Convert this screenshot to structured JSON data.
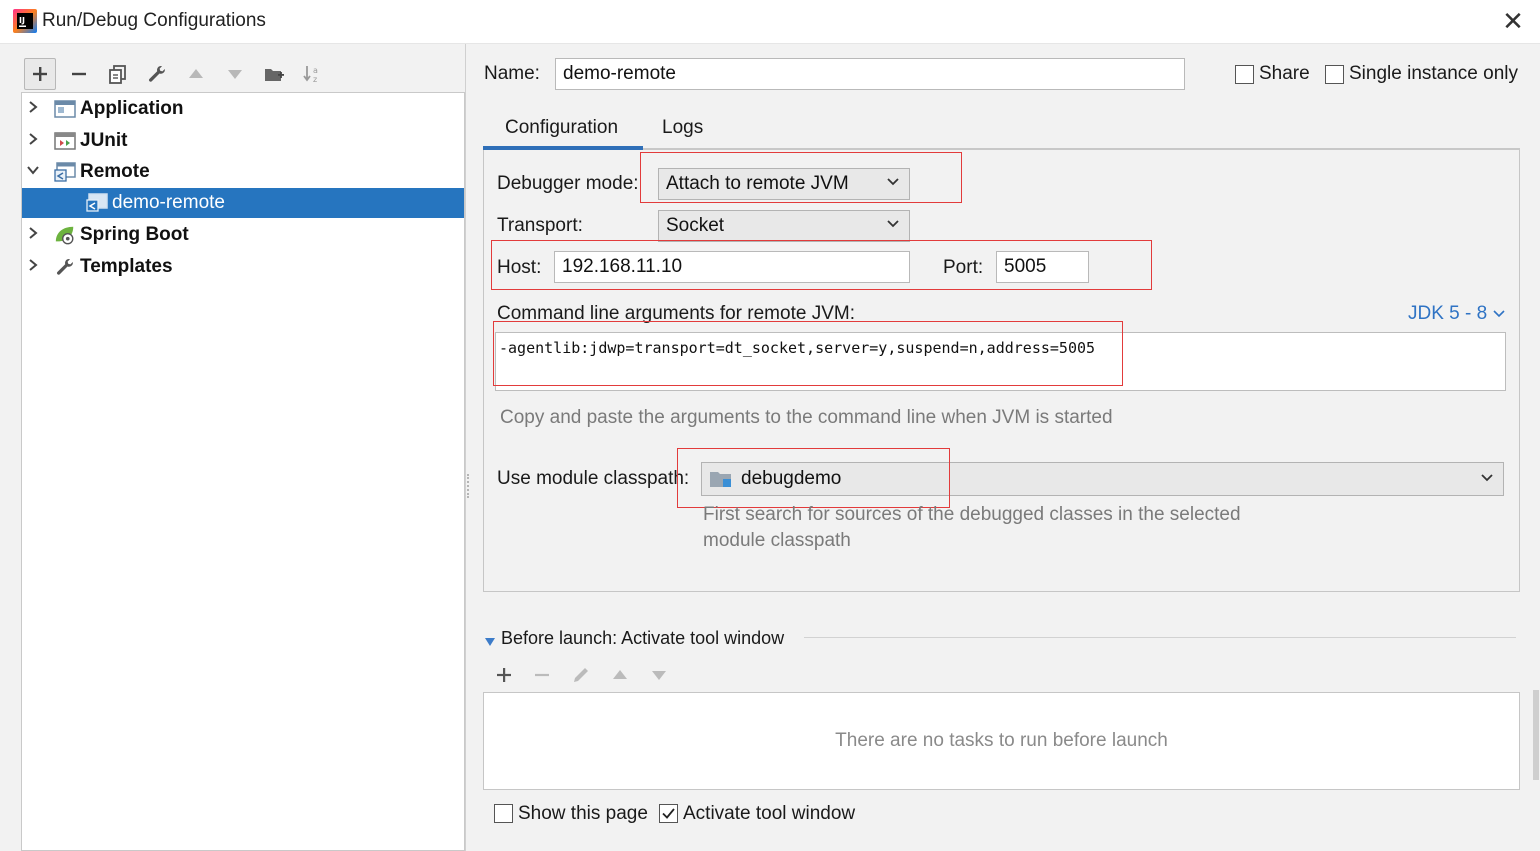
{
  "window": {
    "title": "Run/Debug Configurations",
    "close_glyph": "✕"
  },
  "left_toolbar": {
    "buttons": [
      {
        "name": "add",
        "glyph": "+"
      },
      {
        "name": "remove",
        "glyph": "−"
      },
      {
        "name": "copy",
        "glyph": "⧉"
      },
      {
        "name": "edit-defaults",
        "glyph": "🔧"
      },
      {
        "name": "move-up",
        "glyph": "▲"
      },
      {
        "name": "move-down",
        "glyph": "▼"
      },
      {
        "name": "new-folder",
        "glyph": "📁"
      },
      {
        "name": "sort",
        "glyph": "↓a"
      }
    ]
  },
  "tree": {
    "items": [
      {
        "label": "Application",
        "expanded": false,
        "icon": "application-icon"
      },
      {
        "label": "JUnit",
        "expanded": false,
        "icon": "junit-icon"
      },
      {
        "label": "Remote",
        "expanded": true,
        "icon": "remote-icon"
      },
      {
        "label": "demo-remote",
        "child": true,
        "selected": true,
        "icon": "remote-config-icon"
      },
      {
        "label": "Spring Boot",
        "expanded": false,
        "icon": "spring-boot-icon"
      },
      {
        "label": "Templates",
        "expanded": false,
        "icon": "wrench-icon"
      }
    ]
  },
  "header": {
    "name_label": "Name:",
    "name_value": "demo-remote",
    "share_label": "Share",
    "share_checked": false,
    "single_instance_label": "Single instance only",
    "single_instance_checked": false
  },
  "tabs": [
    {
      "label": "Configuration",
      "active": true
    },
    {
      "label": "Logs",
      "active": false
    }
  ],
  "config": {
    "debugger_mode_label": "Debugger mode:",
    "debugger_mode_value": "Attach to remote JVM",
    "transport_label": "Transport:",
    "transport_value": "Socket",
    "host_label": "Host:",
    "host_value": "192.168.11.10",
    "port_label": "Port:",
    "port_value": "5005",
    "cmd_label": "Command line arguments for remote JVM:",
    "jdk_link": "JDK 5 - 8",
    "cmd_value": "-agentlib:jdwp=transport=dt_socket,server=y,suspend=n,address=5005",
    "cmd_hint": "Copy and paste the arguments to the command line when JVM is started",
    "module_label": "Use module classpath:",
    "module_value": "debugdemo",
    "module_hint_line1": "First search for sources of the debugged classes in the selected",
    "module_hint_line2": "module classpath"
  },
  "before_launch": {
    "title": "Before launch: Activate tool window",
    "empty_text": "There are no tasks to run before launch",
    "toolbar": [
      "+",
      "−",
      "✎",
      "▲",
      "▼"
    ]
  },
  "footer": {
    "show_page_label": "Show this page",
    "show_page_checked": false,
    "activate_label": "Activate tool window",
    "activate_checked": true
  },
  "colors": {
    "selection": "#2675bf",
    "link": "#2f73c4",
    "annotation_red": "#e23b3b"
  }
}
